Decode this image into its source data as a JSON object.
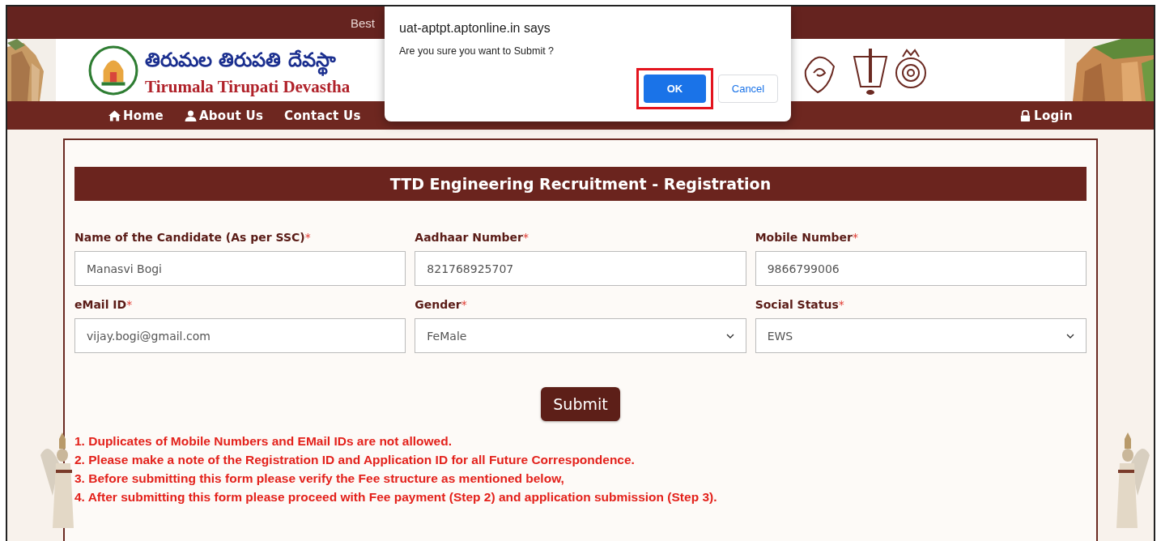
{
  "top_bar": {
    "text": "Best"
  },
  "header": {
    "title_telugu": "తిరుమల తిరుపతి దేవస్థా",
    "title_english": "Tirumala Tirupati Devastha"
  },
  "nav": {
    "left": [
      {
        "label": "Home",
        "kind": "home"
      },
      {
        "label": "About Us",
        "kind": "user"
      },
      {
        "label": "Contact Us",
        "kind": "plain"
      }
    ],
    "right": {
      "label": "Login",
      "kind": "lock"
    }
  },
  "form": {
    "title": "TTD Engineering Recruitment - Registration",
    "fields": [
      {
        "label": "Name of the Candidate (As per SSC)",
        "required_mark": "*",
        "kind": "text",
        "value": "Manasvi Bogi"
      },
      {
        "label": "Aadhaar Number",
        "required_mark": "*",
        "kind": "text",
        "value": "821768925707"
      },
      {
        "label": "Mobile Number",
        "required_mark": "*",
        "kind": "text",
        "value": "9866799006"
      },
      {
        "label": "eMail ID",
        "required_mark": "*",
        "kind": "text",
        "value": "vijay.bogi@gmail.com"
      },
      {
        "label": "Gender",
        "required_mark": "*",
        "kind": "select",
        "value": "FeMale"
      },
      {
        "label": "Social Status",
        "required_mark": "*",
        "kind": "select",
        "value": "EWS"
      }
    ],
    "submit": "Submit",
    "notes": [
      "1. Duplicates of Mobile Numbers and EMail IDs are not allowed.",
      "2. Please make a note of the Registration ID and Application ID for all Future Correspondence.",
      "3. Before submitting this form please verify the Fee structure as mentioned below,",
      "4. After submitting this form please proceed with Fee payment (Step 2) and application submission (Step 3)."
    ]
  },
  "dialog": {
    "title": "uat-aptpt.aptonline.in says",
    "message": "Are you sure you want to Submit ?",
    "buttons": [
      {
        "label": "OK",
        "kind": "primary",
        "highlighted": true
      },
      {
        "label": "Cancel",
        "kind": "secondary",
        "highlighted": false
      }
    ]
  }
}
